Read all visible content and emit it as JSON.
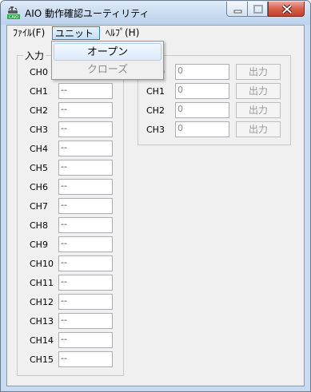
{
  "window": {
    "title": "AIO 動作確認ユーティリティ",
    "icon": "caio-app-icon",
    "controls": [
      "minimize-icon",
      "maximize-icon",
      "close-icon"
    ]
  },
  "menu": {
    "items": [
      "ﾌｧｲﾙ(F)",
      "ユニット",
      "ﾍﾙﾌﾟ(H)"
    ],
    "active": "ユニット"
  },
  "dropdown": {
    "items": [
      {
        "label": "オープン",
        "state": "highlighted"
      },
      {
        "label": "クローズ",
        "state": "disabled"
      }
    ]
  },
  "input_group": {
    "title": "入力",
    "channels": [
      "CH0",
      "CH1",
      "CH2",
      "CH3",
      "CH4",
      "CH5",
      "CH6",
      "CH7",
      "CH8",
      "CH9",
      "CH10",
      "CH11",
      "CH12",
      "CH13",
      "CH14",
      "CH15"
    ],
    "values": [
      "--",
      "--",
      "--",
      "--",
      "--",
      "--",
      "--",
      "--",
      "--",
      "--",
      "--",
      "--",
      "--",
      "--",
      "--",
      "--"
    ]
  },
  "output_group": {
    "channels": [
      "CH0",
      "CH1",
      "CH2",
      "CH3"
    ],
    "values": [
      "0",
      "0",
      "0",
      "0"
    ],
    "button_label": "出力"
  }
}
